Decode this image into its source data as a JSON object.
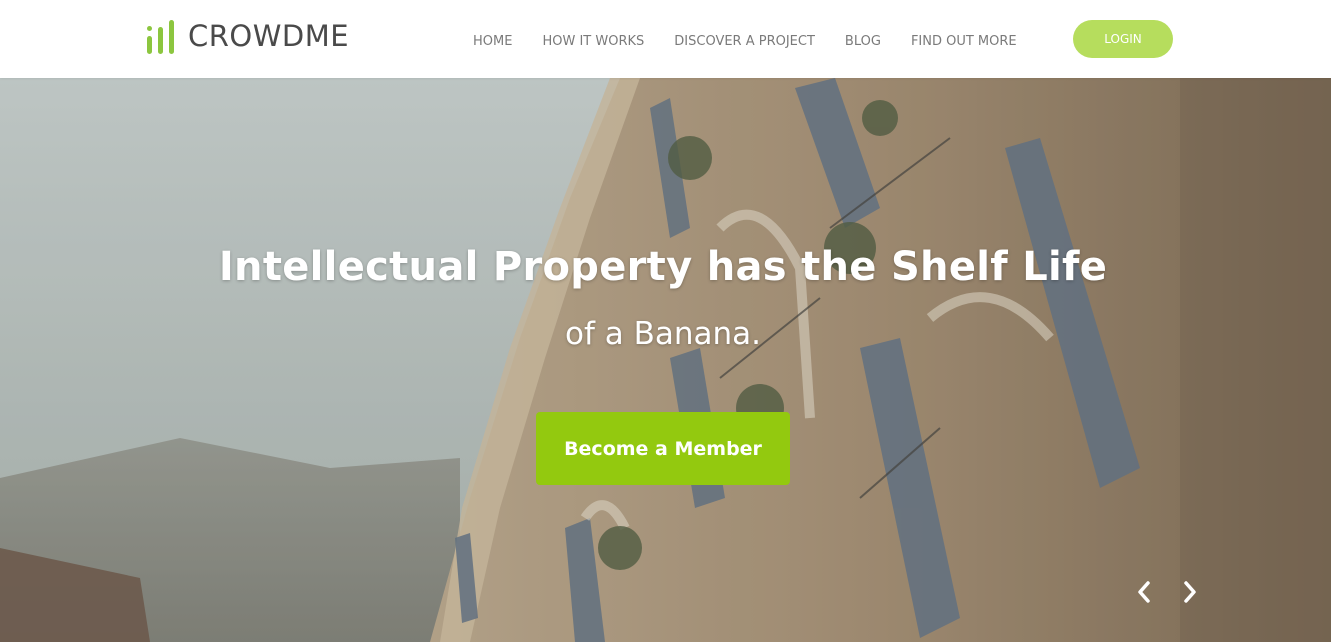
{
  "brand": {
    "name": "CROWDME",
    "accent_color": "#8cc63f"
  },
  "nav": {
    "items": [
      "HOME",
      "HOW IT WORKS",
      "DISCOVER A PROJECT",
      "BLOG",
      "FIND OUT MORE"
    ],
    "login_label": "LOGIN",
    "login_color": "#b6dd5d"
  },
  "hero": {
    "title": "Intellectual Property has the Shelf Life",
    "subtitle": "of a Banana.",
    "cta_label": "Become a Member",
    "cta_color": "#93c90f",
    "background_icon": "stone-building-photo",
    "prev_icon": "chevron-left-icon",
    "next_icon": "chevron-right-icon"
  }
}
